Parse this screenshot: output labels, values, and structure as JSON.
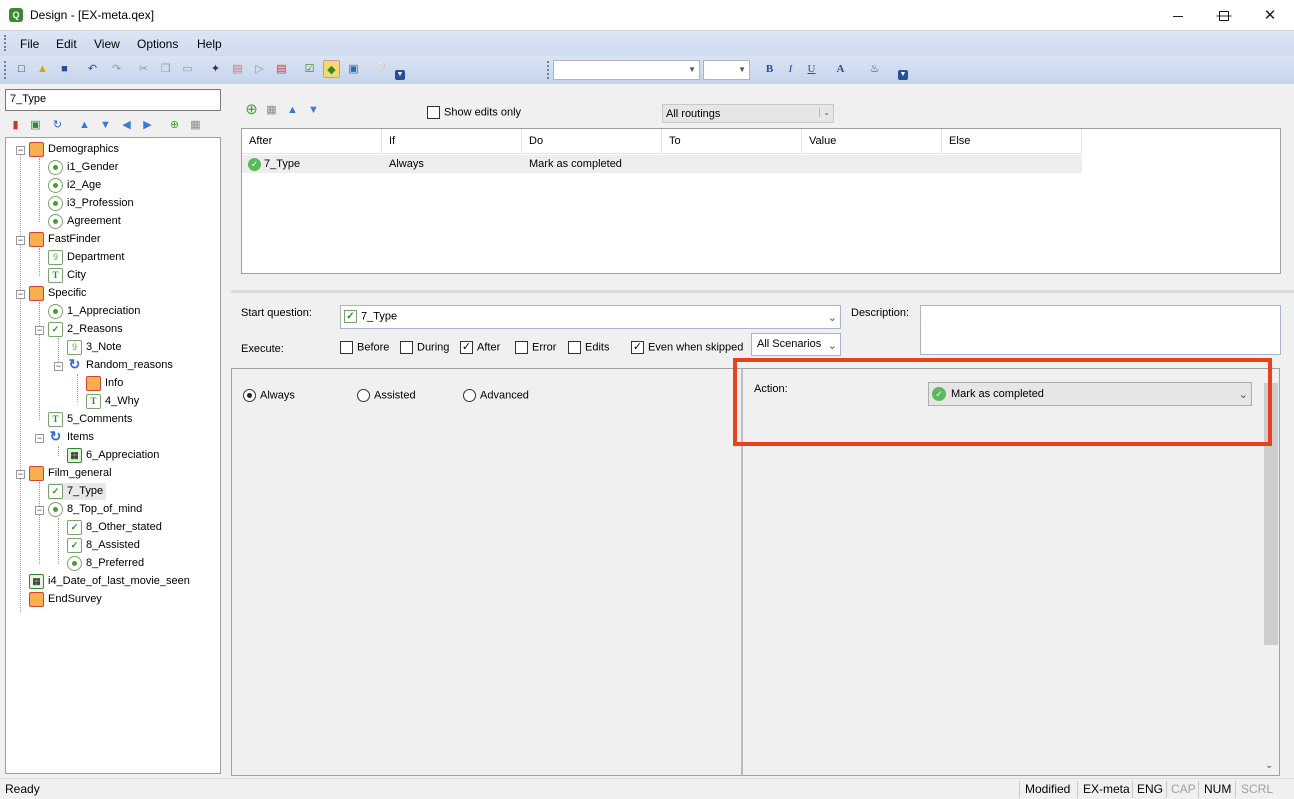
{
  "window": {
    "title": "Design - [EX-meta.qex]",
    "app_icon": "Q"
  },
  "menu": [
    "File",
    "Edit",
    "View",
    "Options",
    "Help"
  ],
  "toolbar": {
    "font_combo": "",
    "size_combo": "",
    "bold": "B",
    "italic": "I",
    "underline": "U",
    "font_color": "A"
  },
  "left": {
    "search_value": "7_Type"
  },
  "tree": [
    {
      "label": "Demographics",
      "icon": "section-icon"
    },
    {
      "label": "i1_Gender",
      "icon": "radio-question-icon"
    },
    {
      "label": "i2_Age",
      "icon": "radio-question-icon"
    },
    {
      "label": "i3_Profession",
      "icon": "radio-question-icon"
    },
    {
      "label": "Agreement",
      "icon": "radio-question-icon"
    },
    {
      "label": "FastFinder",
      "icon": "section-icon"
    },
    {
      "label": "Department",
      "icon": "numeric-question-icon"
    },
    {
      "label": "City",
      "icon": "text-question-icon"
    },
    {
      "label": "Specific",
      "icon": "section-icon"
    },
    {
      "label": "1_Appreciation",
      "icon": "radio-question-icon"
    },
    {
      "label": "2_Reasons",
      "icon": "checkbox-question-icon"
    },
    {
      "label": "3_Note",
      "icon": "numeric-question-icon"
    },
    {
      "label": "Random_reasons",
      "icon": "loop-icon"
    },
    {
      "label": "Info",
      "icon": "section-icon"
    },
    {
      "label": "4_Why",
      "icon": "text-question-icon"
    },
    {
      "label": "5_Comments",
      "icon": "text-question-icon"
    },
    {
      "label": "Items",
      "icon": "loop-icon"
    },
    {
      "label": "6_Appreciation",
      "icon": "grid-question-icon"
    },
    {
      "label": "Film_general",
      "icon": "section-icon"
    },
    {
      "label": "7_Type",
      "icon": "checkbox-question-icon"
    },
    {
      "label": "8_Top_of_mind",
      "icon": "radio-question-icon"
    },
    {
      "label": "8_Other_stated",
      "icon": "checkbox-question-icon"
    },
    {
      "label": "8_Assisted",
      "icon": "checkbox-question-icon"
    },
    {
      "label": "8_Preferred",
      "icon": "radio-question-icon"
    },
    {
      "label": "i4_Date_of_last_movie_seen",
      "icon": "date-question-icon"
    },
    {
      "label": "EndSurvey",
      "icon": "section-icon"
    }
  ],
  "routing": {
    "show_edits_only": "Show edits only",
    "filter": "All routings",
    "columns": [
      "After",
      "If",
      "Do",
      "To",
      "Value",
      "Else"
    ],
    "row": {
      "after": "7_Type",
      "if": "Always",
      "do": "Mark as completed",
      "to": "",
      "value": "",
      "else": ""
    }
  },
  "editor": {
    "start_question_label": "Start question:",
    "start_question_value": "7_Type",
    "description_label": "Description:",
    "execute_label": "Execute:",
    "execute_options": [
      {
        "label": "Before",
        "checked": false
      },
      {
        "label": "During",
        "checked": false
      },
      {
        "label": "After",
        "checked": true
      },
      {
        "label": "Error",
        "checked": false
      },
      {
        "label": "Edits",
        "checked": false
      },
      {
        "label": "Even when skipped",
        "checked": true
      }
    ],
    "scenarios": "All Scenarios",
    "mode_options": [
      {
        "label": "Always",
        "selected": true
      },
      {
        "label": "Assisted",
        "selected": false
      },
      {
        "label": "Advanced",
        "selected": false
      }
    ],
    "action_label": "Action:",
    "action_value": "Mark as completed"
  },
  "status": {
    "left": "Ready",
    "modified": "Modified",
    "file": "EX-meta",
    "lang": "ENG",
    "cap": "CAP",
    "num": "NUM",
    "scrl": "SCRL"
  },
  "colors": {
    "highlight": "#e8421a",
    "menu_bg": "#dbe5f4"
  }
}
